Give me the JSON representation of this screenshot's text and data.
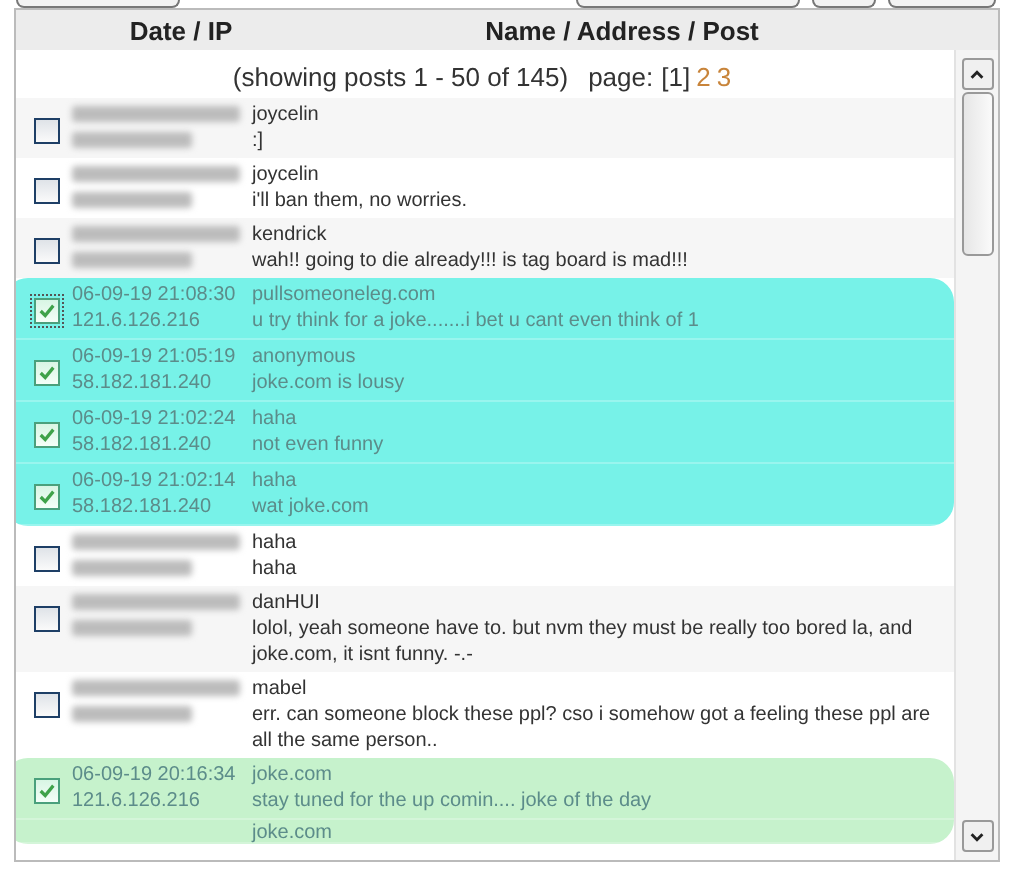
{
  "top_buttons": [
    {
      "kind": "button"
    },
    {
      "kind": "spacer"
    },
    {
      "kind": "button"
    },
    {
      "kind": "button"
    },
    {
      "kind": "button"
    }
  ],
  "table": {
    "columns": [
      "Date / IP",
      "Name / Address / Post"
    ],
    "summary": "(showing posts 1 - 50 of 145)",
    "pages_label": "page:",
    "pages": [
      {
        "label": "[1]",
        "selected": true
      },
      {
        "label": "2",
        "selected": false
      },
      {
        "label": "3",
        "selected": false
      }
    ],
    "rows": [
      {
        "kind": "redacted",
        "checked": false,
        "focused": false,
        "name": "joycelin",
        "post": ":]"
      },
      {
        "kind": "redacted",
        "checked": false,
        "focused": false,
        "name": "joycelin",
        "post": "i'll ban them, no worries."
      },
      {
        "kind": "redacted",
        "checked": false,
        "focused": false,
        "name": "kendrick",
        "post": "wah!! going to die already!!! is tag board is mad!!!"
      },
      {
        "kind": "shown",
        "checked": true,
        "focused": true,
        "color": "#77f2e8",
        "date": "06-09-19 21:08:30",
        "ip": "121.6.126.216",
        "name": "pullsomeoneleg.com",
        "post": "u try think for a joke.......i bet u cant even think of 1"
      },
      {
        "kind": "shown",
        "checked": true,
        "focused": false,
        "color": "#77f2e8",
        "date": "06-09-19 21:05:19",
        "ip": "58.182.181.240",
        "name": "anonymous",
        "post": "joke.com is lousy"
      },
      {
        "kind": "shown",
        "checked": true,
        "focused": false,
        "color": "#77f2e8",
        "date": "06-09-19 21:02:24",
        "ip": "58.182.181.240",
        "name": "haha",
        "post": "not even funny"
      },
      {
        "kind": "shown",
        "checked": true,
        "focused": false,
        "color": "#77f2e8",
        "date": "06-09-19 21:02:14",
        "ip": "58.182.181.240",
        "name": "haha",
        "post": "wat joke.com"
      },
      {
        "kind": "redacted",
        "checked": false,
        "focused": false,
        "name": "haha",
        "post": "haha"
      },
      {
        "kind": "redacted",
        "checked": false,
        "focused": false,
        "name": "danHUI",
        "post": "lolol, yeah someone have to. but nvm they must be really too bored la, and joke.com, it isnt funny. -.-"
      },
      {
        "kind": "redacted",
        "checked": false,
        "focused": false,
        "name": "mabel",
        "post": "err. can someone block these ppl? cso i somehow got a feeling these ppl are all the same person.."
      },
      {
        "kind": "shown",
        "checked": true,
        "focused": false,
        "color": "#c6f2cc",
        "date": "06-09-19 20:16:34",
        "ip": "121.6.126.216",
        "name": "joke.com",
        "post": "stay tuned for the up comin.... joke of the day"
      },
      {
        "kind": "partial",
        "focused": false,
        "color": "#c6f2cc",
        "name": "joke.com"
      }
    ]
  }
}
